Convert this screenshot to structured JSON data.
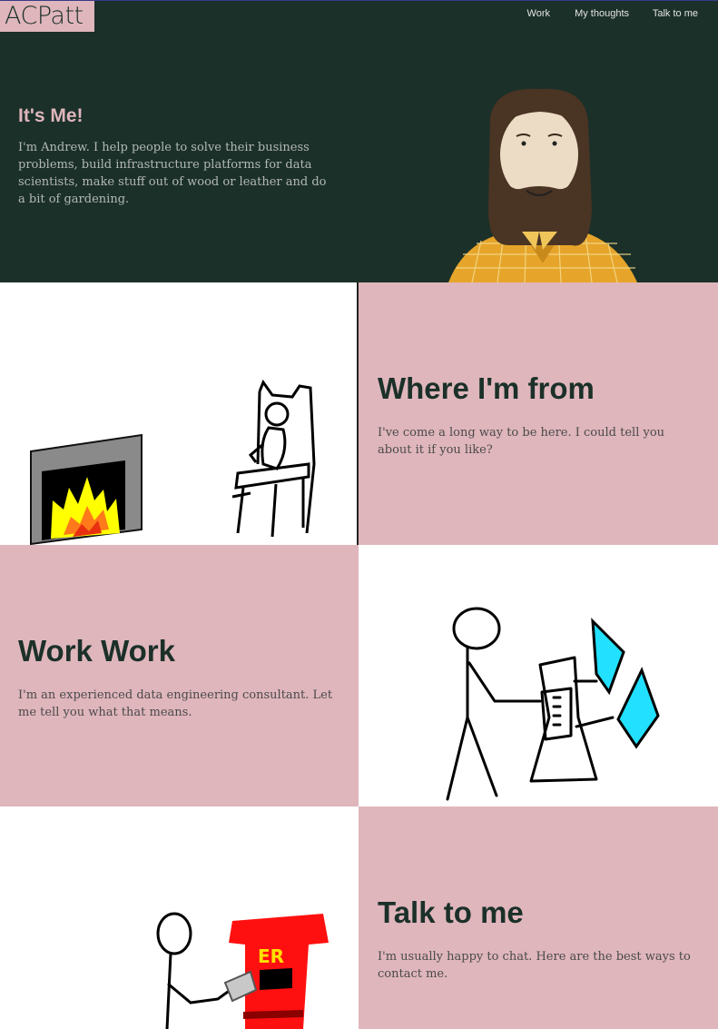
{
  "header": {
    "logo_text": "ACPatt",
    "nav": [
      {
        "label": "Work"
      },
      {
        "label": "My thoughts"
      },
      {
        "label": "Talk to me"
      }
    ]
  },
  "hero": {
    "title": "It's Me!",
    "text": "I'm Andrew. I help people to solve their business problems, build infrastructure platforms for data scientists, make stuff out of wood or leather and do a bit of gardening."
  },
  "sections": [
    {
      "title": "Where I'm from",
      "text": "I've come a long way to be here. I could tell you about it if you like?"
    },
    {
      "title": "Work Work",
      "text": "I'm an experienced data engineering consultant. Let me tell you what that means."
    },
    {
      "title": "Talk to me",
      "text": "I'm usually happy to chat. Here are the best ways to contact me."
    }
  ],
  "illustrations": {
    "postbox_text": "ER"
  },
  "colors": {
    "hero_bg": "#1b3029",
    "accent_pink": "#dfb6bc",
    "text_dark": "#1b3029"
  }
}
